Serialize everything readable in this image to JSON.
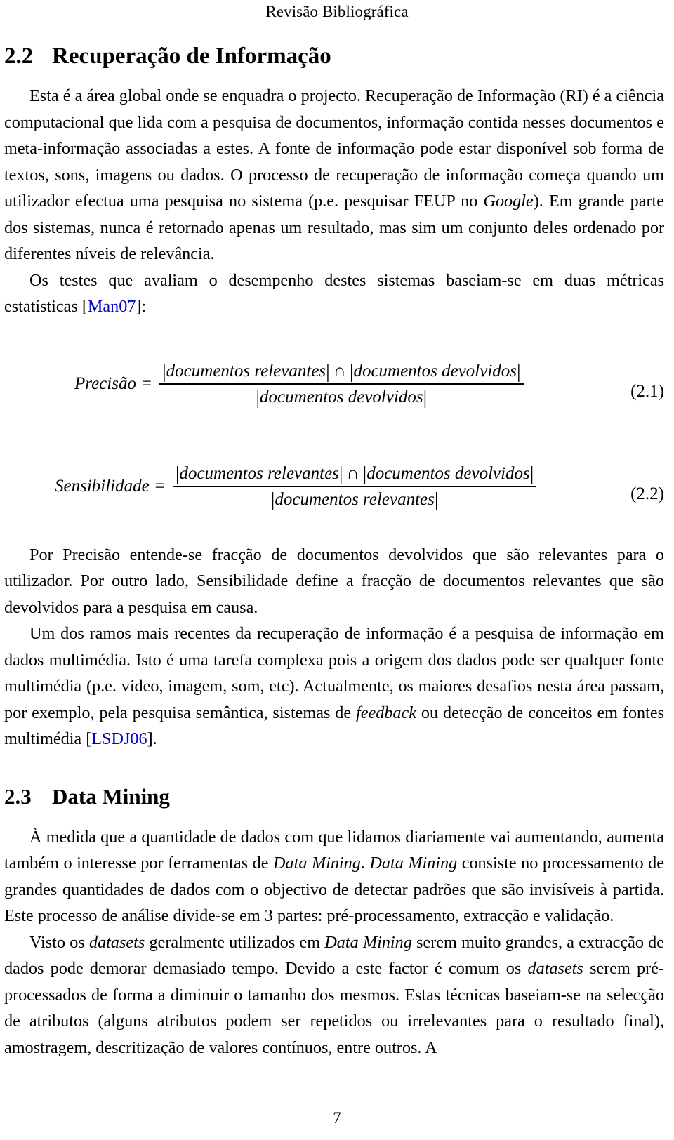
{
  "running_header": "Revisão Bibliográfica",
  "page_number": "7",
  "sections": [
    {
      "number": "2.2",
      "title": "Recuperação de Informação"
    },
    {
      "number": "2.3",
      "title": "Data Mining"
    }
  ],
  "paragraphs": {
    "p1_a": "Esta é a área global onde se enquadra o projecto. Recuperação de Informação (RI) é a ciência computacional que lida com a pesquisa de documentos, informação contida nesses documentos e meta-informação associadas a estes. A fonte de informação pode estar disponível sob forma de textos, sons, imagens ou dados. O processo de recuperação de informação começa quando um utilizador efectua uma pesquisa no sistema (p.e. pesquisar FEUP no ",
    "p1_italic": "Google",
    "p1_b": "). Em grande parte dos sistemas, nunca é retornado apenas um resultado, mas sim um conjunto deles ordenado por diferentes níveis de relevância.",
    "p2_a": "Os testes que avaliam o desempenho destes sistemas baseiam-se em duas métricas estatísticas [",
    "p2_cite": "Man07",
    "p2_b": "]:",
    "p3": "Por Precisão entende-se fracção de documentos devolvidos que são relevantes para o utilizador. Por outro lado, Sensibilidade define a fracção de documentos relevantes que são devolvidos para a pesquisa em causa.",
    "p4_a": "Um dos ramos mais recentes da recuperação de informação é a pesquisa de informação em dados multimédia. Isto é uma tarefa complexa pois a origem dos dados pode ser qualquer fonte multimédia (p.e. vídeo, imagem, som, etc). Actualmente, os maiores desafios nesta área passam, por exemplo, pela pesquisa semântica, sistemas de ",
    "p4_italic": "feedback",
    "p4_b": " ou detecção de conceitos em fontes multimédia [",
    "p4_cite": "LSDJ06",
    "p4_c": "].",
    "p5_a": "À medida que a quantidade de dados com que lidamos diariamente vai aumentando, aumenta também o interesse por ferramentas de ",
    "p5_it1": "Data Mining",
    "p5_b": ". ",
    "p5_it2": "Data Mining",
    "p5_c": " consiste no processamento de grandes quantidades de dados com o objectivo de detectar padrões que são invisíveis à partida. Este processo de análise divide-se em 3 partes: pré-processamento, extracção e validação.",
    "p6_a": "Visto os ",
    "p6_it1": "datasets",
    "p6_b": " geralmente utilizados em ",
    "p6_it2": "Data Mining",
    "p6_c": " serem muito grandes, a extracção de dados pode demorar demasiado tempo. Devido a este factor é comum os ",
    "p6_it3": "datasets",
    "p6_d": " serem pré-processados de forma a diminuir o tamanho dos mesmos. Estas técnicas baseiam-se na selecção de atributos (alguns atributos podem ser repetidos ou irrelevantes para o resultado final), amostragem, descritização de valores contínuos, entre outros. A"
  },
  "equations": [
    {
      "id": "eq-2-1",
      "lhs": "Precisão =",
      "numerator_left": "documentos relevantes",
      "operator": "∩",
      "numerator_right": "documentos devolvidos",
      "denominator": "documentos devolvidos",
      "number": "(2.1)"
    },
    {
      "id": "eq-2-2",
      "lhs": "Sensibilidade =",
      "numerator_left": "documentos relevantes",
      "operator": "∩",
      "numerator_right": "documentos devolvidos",
      "denominator": "documentos relevantes",
      "number": "(2.2)"
    }
  ],
  "colors": {
    "text": "#000000",
    "citation_link": "#0000cd",
    "background": "#ffffff"
  }
}
